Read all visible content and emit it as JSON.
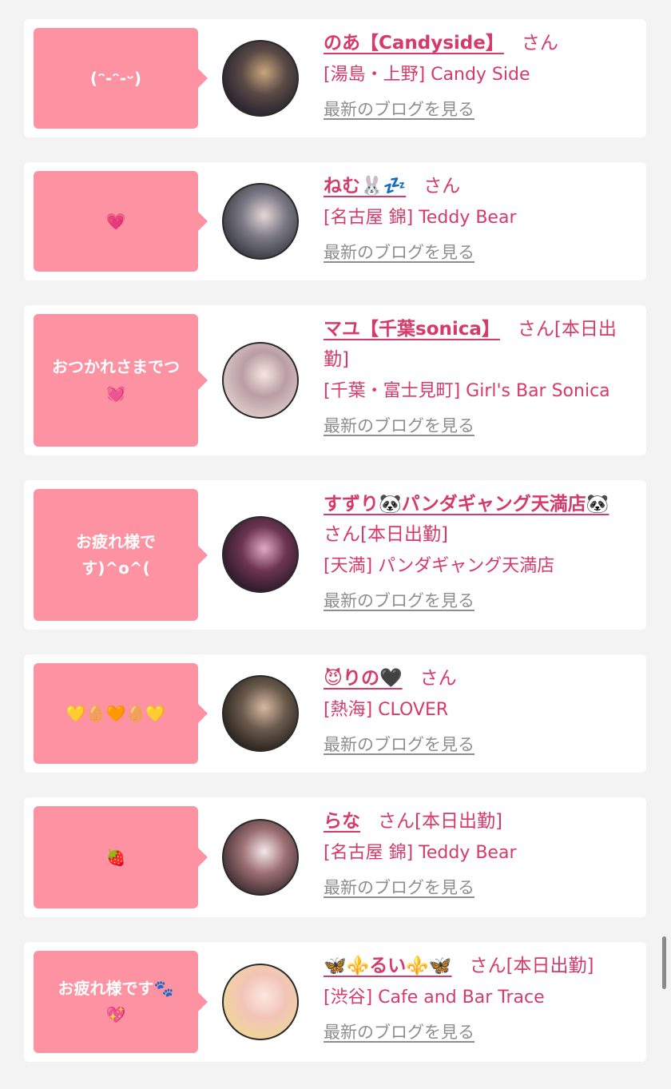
{
  "entries": [
    {
      "message": "(ᵔ-ᵔ-ᵕ)",
      "name": "のあ【Candyside】",
      "suffix": "さん",
      "shop": "[湯島・上野] Candy Side",
      "blog_link": "最新のブログを見る",
      "avatar_colors": [
        "#1b1a28",
        "#5a4a46",
        "#c9a57a"
      ]
    },
    {
      "message": "💗",
      "name": "ねむ🐰💤",
      "suffix": "さん",
      "shop": "[名古屋 錦] Teddy Bear",
      "blog_link": "最新のブログを見る",
      "avatar_colors": [
        "#2c2c35",
        "#7b7a86",
        "#e8d7d7"
      ]
    },
    {
      "message": "おつかれさまでつ\n💓",
      "name": "マユ【千葉sonica】",
      "suffix": "さん[本日出勤]",
      "shop": "[千葉・富士見町] Girl's Bar Sonica",
      "blog_link": "最新のブログを見る",
      "avatar_colors": [
        "#e7d5d2",
        "#b99ea3",
        "#f6e6e1"
      ]
    },
    {
      "message": "お疲れ様で\nす)^o^(",
      "name": "すずり🐼パンダギャング天満店🐼",
      "suffix": "さん[本日出勤]",
      "shop": "[天満] パンダギャング天満店",
      "blog_link": "最新のブログを見る",
      "avatar_colors": [
        "#1d1323",
        "#6d3551",
        "#e1a9c2"
      ]
    },
    {
      "message": "💛🥚🧡🥚💛",
      "name": "😈りの🖤",
      "suffix": "さん",
      "shop": "[熱海] CLOVER",
      "blog_link": "最新のブログを見る",
      "avatar_colors": [
        "#1a1613",
        "#6a5a4c",
        "#d8b9a2"
      ]
    },
    {
      "message": "🍓",
      "name": "らな",
      "suffix": "さん[本日出勤]",
      "shop": "[名古屋 錦] Teddy Bear",
      "blog_link": "最新のブログを見る",
      "avatar_colors": [
        "#2a2024",
        "#9d6f72",
        "#f3e8ea"
      ]
    },
    {
      "message": "お疲れ様です🐾\n💖",
      "name": "🦋⚜️るい⚜️🦋",
      "suffix": "さん[本日出勤]",
      "shop": "[渋谷] Cafe and Bar Trace",
      "blog_link": "最新のブログを見る",
      "avatar_colors": [
        "#f0d991",
        "#f2c4b8",
        "#fbe7e0"
      ]
    }
  ]
}
